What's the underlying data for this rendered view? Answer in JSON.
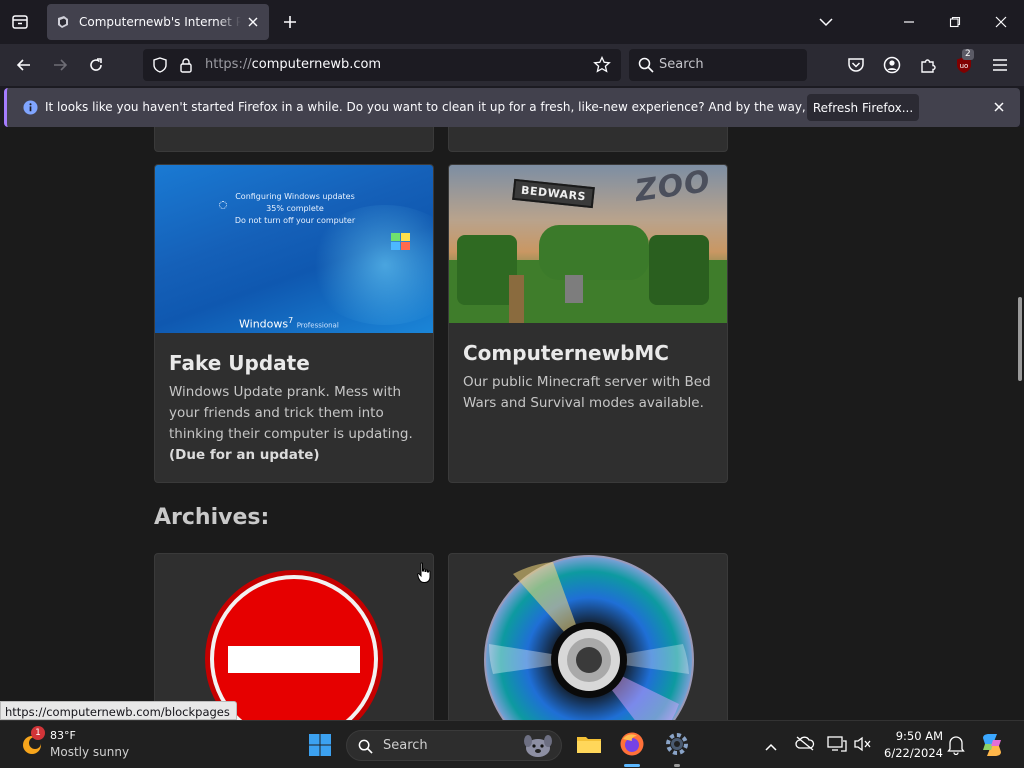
{
  "browser": {
    "tab_title": "Computernewb's Internet Pub",
    "url_protocol": "https://",
    "url_host": "computernewb.com",
    "search_placeholder": "Search",
    "extension_badge": "2",
    "notification": {
      "message": "It looks like you haven't started Firefox in a while. Do you want to clean it up for a fresh, like-new experience? And by the way, welcome back!",
      "button_label": "Refresh Firefox..."
    },
    "status_link": "https://computernewb.com/blockpages"
  },
  "page": {
    "cards": [
      {
        "title": "Fake Update",
        "description": "Windows Update prank. Mess with your friends and trick them into thinking their computer is updating.",
        "note": "(Due for an update)",
        "thumb": {
          "line1": "Configuring Windows updates",
          "line2": "35% complete",
          "line3": "Do not turn off your computer",
          "brand": "Windows",
          "brand_ver": "7",
          "edition": "Professional"
        }
      },
      {
        "title": "ComputernewbMC",
        "description": "Our public Minecraft server with Bed Wars and Survival modes available.",
        "thumb": {
          "sign": "BEDWARS",
          "zoo": "ZOO"
        }
      }
    ],
    "archives_heading": "Archives:"
  },
  "taskbar": {
    "weather_temp": "83°F",
    "weather_desc": "Mostly sunny",
    "weather_badge": "1",
    "search_placeholder": "Search",
    "time": "9:50 AM",
    "date": "6/22/2024"
  },
  "colors": {
    "accent_purple": "#a67dff",
    "info_blue": "#0060df",
    "page_bg": "#1b1b1b",
    "card_bg": "#2f2f2f"
  }
}
